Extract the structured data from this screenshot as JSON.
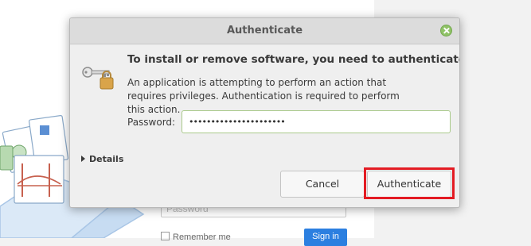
{
  "background": {
    "password_placeholder": "Password",
    "remember_label": "Remember me",
    "signin_label": "Sign in"
  },
  "dialog": {
    "title": "Authenticate",
    "heading": "To install or remove software, you need to authenticate.",
    "message": "An application is attempting to perform an action that requires privileges. Authentication is required to perform this action.",
    "password_label": "Password:",
    "password_value": "••••••••••••••••••••••",
    "details_label": "Details",
    "cancel_label": "Cancel",
    "authenticate_label": "Authenticate"
  },
  "colors": {
    "highlight": "#e31b23",
    "close_button": "#8fc266",
    "field_focus": "#a9c98a"
  },
  "icons": {
    "close": "close-icon",
    "key": "key-lock-icon",
    "details": "triangle-right-icon"
  }
}
